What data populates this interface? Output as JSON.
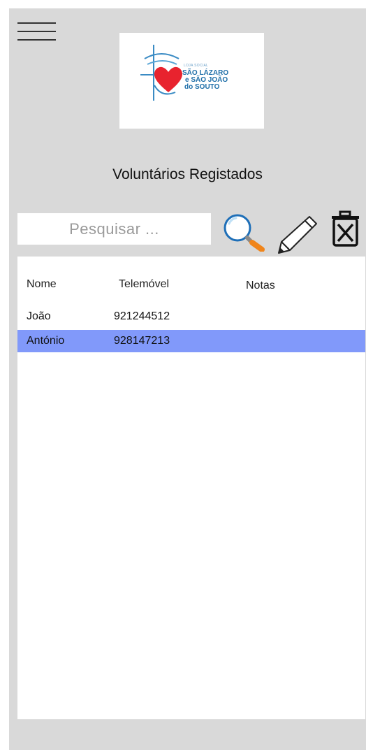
{
  "header": {
    "title": "Voluntários Registados"
  },
  "logo": {
    "small_text": "LOJA SOCIAL",
    "line1": "SÃO LÁZARO",
    "line2": "e SÃO JOÃO",
    "line3": "do SOUTO",
    "colors": {
      "heart": "#e8232e",
      "text": "#1d6ea8"
    }
  },
  "search": {
    "placeholder": "Pesquisar ...",
    "value": ""
  },
  "toolbar": {
    "icons": [
      "search-icon",
      "pencil-icon",
      "trash-icon"
    ],
    "accent": "#f0851b"
  },
  "table": {
    "columns": [
      "Nome",
      "Telemóvel",
      "Notas"
    ],
    "rows": [
      {
        "name": "João",
        "phone": "921244512",
        "notes": ""
      },
      {
        "name": "António",
        "phone": "928147213",
        "notes": ""
      }
    ],
    "selected_row": 1,
    "selected_color": "#8199fa"
  }
}
